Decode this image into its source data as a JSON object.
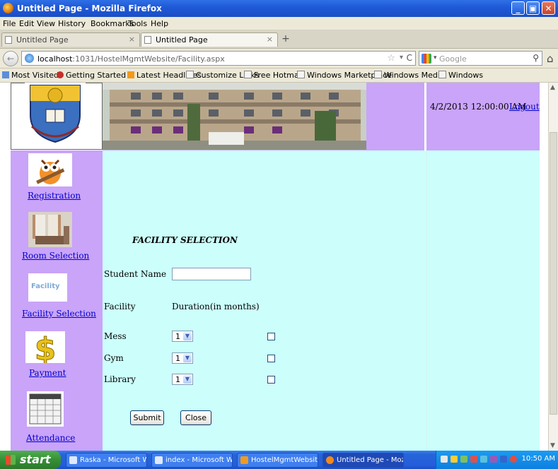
{
  "window": {
    "title": "Untitled Page - Mozilla Firefox"
  },
  "menu": [
    "File",
    "Edit",
    "View",
    "History",
    "Bookmarks",
    "Tools",
    "Help"
  ],
  "tabs": [
    {
      "label": "Untitled Page",
      "active": false
    },
    {
      "label": "Untitled Page",
      "active": true
    }
  ],
  "nav": {
    "url_host": "localhost",
    "url_path": ":1031/HostelMgmtWebsite/Facility.aspx",
    "search_placeholder": "Google"
  },
  "bookmarks": [
    "Most Visited",
    "Getting Started",
    "Latest Headlines",
    "Customize Links",
    "Free Hotmail",
    "Windows Marketplace",
    "Windows Media",
    "Windows"
  ],
  "header": {
    "datetime": "4/2/2013 12:00:00 AM",
    "logout_label": "Logout"
  },
  "sidebar": {
    "items": [
      {
        "label": "Registration",
        "icon": "owl-icon"
      },
      {
        "label": "Room Selection",
        "icon": "room-photo-icon"
      },
      {
        "label": "Facility Selection",
        "icon": "facility-logo-icon",
        "icon_text": "Facility"
      },
      {
        "label": "Payment",
        "icon": "dollar-icon"
      },
      {
        "label": "Attendance",
        "icon": "calendar-icon"
      }
    ]
  },
  "form": {
    "heading": "FACILITY SELECTION",
    "student_name_label": "Student Name",
    "student_name_value": "",
    "facility_header": "Facility",
    "duration_header": "Duration(in months)",
    "rows": [
      {
        "name": "Mess",
        "duration": "1",
        "checked": false
      },
      {
        "name": "Gym",
        "duration": "1",
        "checked": false
      },
      {
        "name": "Library",
        "duration": "1",
        "checked": false
      }
    ],
    "submit_label": "Submit",
    "close_label": "Close"
  },
  "taskbar": {
    "start_label": "start",
    "tasks": [
      {
        "label": "Raska - Microsoft Word"
      },
      {
        "label": "index - Microsoft Word"
      },
      {
        "label": "HostelMgmtWebsite (..."
      },
      {
        "label": "Untitled Page - Mozil..."
      }
    ],
    "clock": "10:50 AM"
  },
  "colors": {
    "sidebar_bg": "#c9a4f8",
    "main_bg": "#ccfffb",
    "titlebar": "#1f58d6",
    "link": "#0000cc"
  }
}
